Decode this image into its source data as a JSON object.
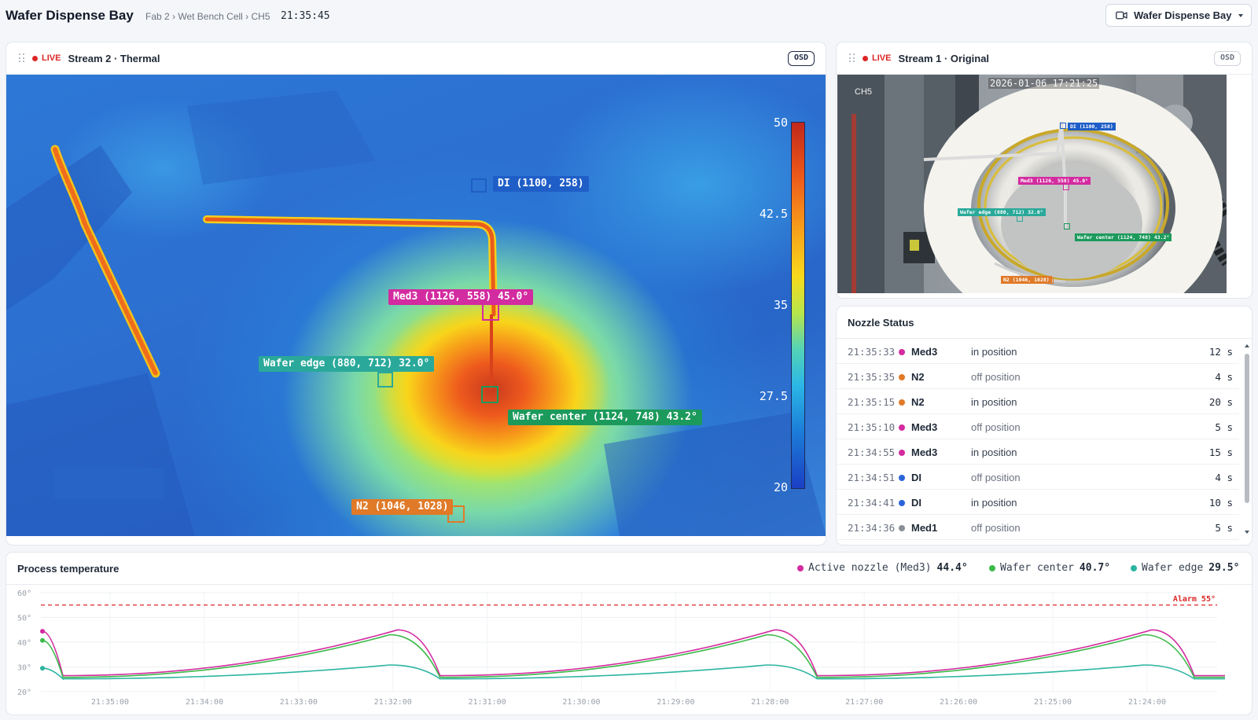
{
  "header": {
    "title": "Wafer Dispense Bay",
    "breadcrumb": "Fab 2 › Wet Bench Cell › CH5",
    "time": "21:35:45",
    "camera_select": "Wafer Dispense Bay"
  },
  "thermal": {
    "live": "LIVE",
    "title": "Stream 2 · Thermal",
    "osd": "OSD",
    "tags": {
      "di": "DI (1100, 258)",
      "med3": "Med3 (1126, 558)  45.0°",
      "edge": "Wafer edge (880, 712)  32.0°",
      "center": "Wafer center (1124, 748)  43.2°",
      "n2": "N2 (1046, 1028)"
    },
    "scale": [
      "50",
      "42.5",
      "35",
      "27.5",
      "20"
    ],
    "colors": {
      "di": "#1f5ec7",
      "med3": "#d32ba0",
      "edge": "#2aa99a",
      "center": "#1c9a5c",
      "n2": "#e07a28"
    }
  },
  "original": {
    "live": "LIVE",
    "title": "Stream 1 · Original",
    "osd": "OSD",
    "timestamp": "2026-01-06 17:21:25",
    "channel": "CH5",
    "tags": {
      "di": "DI (1100, 258)",
      "med3": "Med3 (1126, 558)  45.0°",
      "edge": "Wafer edge (880, 712)  32.0°",
      "center": "Wafer center (1124, 748)  43.2°",
      "n2": "N2 (1046, 1028)"
    }
  },
  "nozzle_status": {
    "title": "Nozzle Status",
    "rows": [
      {
        "time": "21:35:33",
        "nozzle": "Med3",
        "status": "in position",
        "duration": "12 s",
        "color": "#d32ba0"
      },
      {
        "time": "21:35:35",
        "nozzle": "N2",
        "status": "off position",
        "duration": "4 s",
        "color": "#e07a28"
      },
      {
        "time": "21:35:15",
        "nozzle": "N2",
        "status": "in position",
        "duration": "20 s",
        "color": "#e07a28"
      },
      {
        "time": "21:35:10",
        "nozzle": "Med3",
        "status": "off position",
        "duration": "5 s",
        "color": "#d32ba0"
      },
      {
        "time": "21:34:55",
        "nozzle": "Med3",
        "status": "in position",
        "duration": "15 s",
        "color": "#d32ba0"
      },
      {
        "time": "21:34:51",
        "nozzle": "DI",
        "status": "off position",
        "duration": "4 s",
        "color": "#2b63d9"
      },
      {
        "time": "21:34:41",
        "nozzle": "DI",
        "status": "in position",
        "duration": "10 s",
        "color": "#2b63d9"
      },
      {
        "time": "21:34:36",
        "nozzle": "Med1",
        "status": "off position",
        "duration": "5 s",
        "color": "#8a8f98"
      }
    ]
  },
  "process": {
    "title": "Process temperature",
    "legend": [
      {
        "label": "Active nozzle (Med3)",
        "value": "44.4°",
        "color": "#d32ba0"
      },
      {
        "label": "Wafer center",
        "value": "40.7°",
        "color": "#3cba4a"
      },
      {
        "label": "Wafer edge",
        "value": "29.5°",
        "color": "#2bb5a0"
      }
    ]
  },
  "chart_data": {
    "type": "line",
    "title": "Process temperature",
    "y_ticks": [
      "60°",
      "50°",
      "40°",
      "30°",
      "20°"
    ],
    "ylim": [
      20,
      60
    ],
    "x_ticks": [
      "21:35:00",
      "21:34:00",
      "21:33:00",
      "21:32:00",
      "21:31:00",
      "21:30:00",
      "21:29:00",
      "21:28:00",
      "21:27:00",
      "21:26:00",
      "21:25:00",
      "21:24:00"
    ],
    "x_direction": "newest-left",
    "alarm": {
      "value": 55,
      "label": "Alarm 55°",
      "color": "#dc2626"
    },
    "grid": true,
    "cycles": [
      {
        "start_tick": -0.85,
        "peak_tick": 3.05,
        "reset_tick": 3.5
      },
      {
        "start_tick": 3.5,
        "peak_tick": 7.05,
        "reset_tick": 7.5
      },
      {
        "start_tick": 7.5,
        "peak_tick": 11.05,
        "reset_tick": 11.5
      }
    ],
    "series": [
      {
        "name": "Active nozzle (Med3)",
        "color": "#d32ba0",
        "latest": 44.4,
        "base": 26.5,
        "peak": 45.0
      },
      {
        "name": "Wafer center",
        "color": "#3cba4a",
        "latest": 40.7,
        "base": 25.8,
        "peak": 43.0
      },
      {
        "name": "Wafer edge",
        "color": "#2bb5a0",
        "latest": 29.5,
        "base": 25.2,
        "peak": 30.8
      }
    ]
  }
}
